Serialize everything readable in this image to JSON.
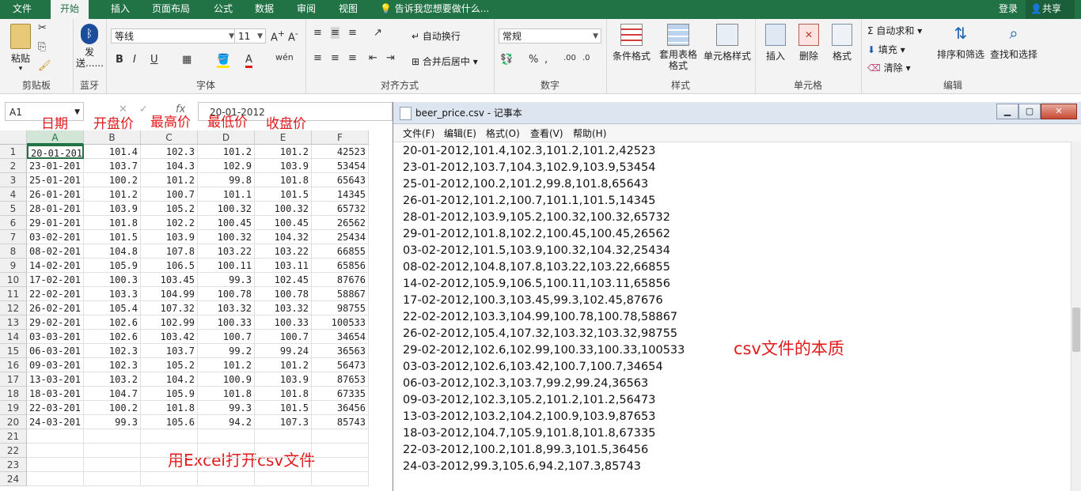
{
  "ribbon_tabs": [
    "文件",
    "开始",
    "插入",
    "页面布局",
    "公式",
    "数据",
    "审阅",
    "视图"
  ],
  "active_tab": "开始",
  "tell_me": "告诉我您想要做什么...",
  "login": "登录",
  "share": "共享",
  "groups": {
    "clipboard": {
      "label": "剪贴板",
      "paste": "粘贴"
    },
    "bluetooth": {
      "label": "蓝牙",
      "send": "发送......"
    },
    "font": {
      "label": "字体",
      "name": "等线",
      "size": "11"
    },
    "align": {
      "label": "对齐方式",
      "wrap": "自动换行",
      "merge": "合并后居中"
    },
    "number": {
      "label": "数字",
      "format": "常规"
    },
    "styles": {
      "label": "样式",
      "cond": "条件格式",
      "table": "套用表格格式",
      "cell": "单元格样式"
    },
    "cells": {
      "label": "单元格",
      "insert": "插入",
      "delete": "删除",
      "format": "格式"
    },
    "edit": {
      "label": "编辑",
      "autosum": "自动求和",
      "fill": "填充",
      "clear": "清除",
      "sort": "排序和筛选",
      "find": "查找和选择"
    }
  },
  "name_box": "A1",
  "formula_value": "20-01-2012",
  "header_labels": [
    "日期",
    "开盘价",
    "最高价",
    "最低价",
    "收盘价"
  ],
  "columns": [
    "A",
    "B",
    "C",
    "D",
    "E",
    "F"
  ],
  "rows": [
    [
      "20-01-201",
      "101.4",
      "102.3",
      "101.2",
      "101.2",
      "42523"
    ],
    [
      "23-01-201",
      "103.7",
      "104.3",
      "102.9",
      "103.9",
      "53454"
    ],
    [
      "25-01-201",
      "100.2",
      "101.2",
      "99.8",
      "101.8",
      "65643"
    ],
    [
      "26-01-201",
      "101.2",
      "100.7",
      "101.1",
      "101.5",
      "14345"
    ],
    [
      "28-01-201",
      "103.9",
      "105.2",
      "100.32",
      "100.32",
      "65732"
    ],
    [
      "29-01-201",
      "101.8",
      "102.2",
      "100.45",
      "100.45",
      "26562"
    ],
    [
      "03-02-201",
      "101.5",
      "103.9",
      "100.32",
      "104.32",
      "25434"
    ],
    [
      "08-02-201",
      "104.8",
      "107.8",
      "103.22",
      "103.22",
      "66855"
    ],
    [
      "14-02-201",
      "105.9",
      "106.5",
      "100.11",
      "103.11",
      "65856"
    ],
    [
      "17-02-201",
      "100.3",
      "103.45",
      "99.3",
      "102.45",
      "87676"
    ],
    [
      "22-02-201",
      "103.3",
      "104.99",
      "100.78",
      "100.78",
      "58867"
    ],
    [
      "26-02-201",
      "105.4",
      "107.32",
      "103.32",
      "103.32",
      "98755"
    ],
    [
      "29-02-201",
      "102.6",
      "102.99",
      "100.33",
      "100.33",
      "100533"
    ],
    [
      "03-03-201",
      "102.6",
      "103.42",
      "100.7",
      "100.7",
      "34654"
    ],
    [
      "06-03-201",
      "102.3",
      "103.7",
      "99.2",
      "99.24",
      "36563"
    ],
    [
      "09-03-201",
      "102.3",
      "105.2",
      "101.2",
      "101.2",
      "56473"
    ],
    [
      "13-03-201",
      "103.2",
      "104.2",
      "100.9",
      "103.9",
      "87653"
    ],
    [
      "18-03-201",
      "104.7",
      "105.9",
      "101.8",
      "101.8",
      "67335"
    ],
    [
      "22-03-201",
      "100.2",
      "101.8",
      "99.3",
      "101.5",
      "36456"
    ],
    [
      "24-03-201",
      "99.3",
      "105.6",
      "94.2",
      "107.3",
      "85743"
    ]
  ],
  "row_numbers": [
    "1",
    "2",
    "3",
    "4",
    "5",
    "6",
    "7",
    "8",
    "9",
    "10",
    "11",
    "12",
    "13",
    "14",
    "15",
    "16",
    "17",
    "18",
    "19",
    "20",
    "21",
    "22",
    "23",
    "24"
  ],
  "excel_note": "用Excel打开csv文件",
  "notepad": {
    "title": "beer_price.csv - 记事本",
    "menu": [
      "文件(F)",
      "编辑(E)",
      "格式(O)",
      "查看(V)",
      "帮助(H)"
    ],
    "lines": [
      "20-01-2012,101.4,102.3,101.2,101.2,42523",
      "23-01-2012,103.7,104.3,102.9,103.9,53454",
      "25-01-2012,100.2,101.2,99.8,101.8,65643",
      "26-01-2012,101.2,100.7,101.1,101.5,14345",
      "28-01-2012,103.9,105.2,100.32,100.32,65732",
      "29-01-2012,101.8,102.2,100.45,100.45,26562",
      "03-02-2012,101.5,103.9,100.32,104.32,25434",
      "08-02-2012,104.8,107.8,103.22,103.22,66855",
      "14-02-2012,105.9,106.5,100.11,103.11,65856",
      "17-02-2012,100.3,103.45,99.3,102.45,87676",
      "22-02-2012,103.3,104.99,100.78,100.78,58867",
      "26-02-2012,105.4,107.32,103.32,103.32,98755",
      "29-02-2012,102.6,102.99,100.33,100.33,100533",
      "03-03-2012,102.6,103.42,100.7,100.7,34654",
      "06-03-2012,102.3,103.7,99.2,99.24,36563",
      "09-03-2012,102.3,105.2,101.2,101.2,56473",
      "13-03-2012,103.2,104.2,100.9,103.9,87653",
      "18-03-2012,104.7,105.9,101.8,101.8,67335",
      "22-03-2012,100.2,101.8,99.3,101.5,36456",
      "24-03-2012,99.3,105.6,94.2,107.3,85743"
    ],
    "note": "csv文件的本质"
  },
  "accent": "#217346",
  "annotation_color": "#e31a1c"
}
